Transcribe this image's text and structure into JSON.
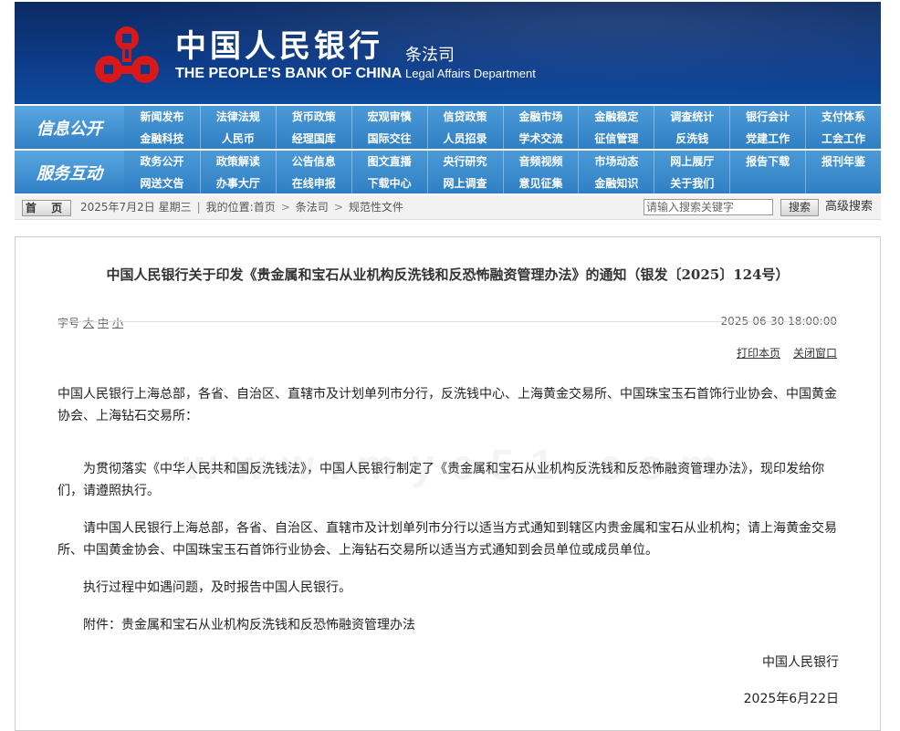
{
  "header": {
    "bank_name_cn": "中国人民银行",
    "bank_name_en": "THE PEOPLE'S BANK OF CHINA",
    "dept_cn": "条法司",
    "dept_en": "Legal Affairs Department",
    "logo_icon": "pboc-logo-icon",
    "logo_color": "#d7191b"
  },
  "nav": {
    "rows": [
      {
        "category": "信息公开",
        "items": [
          "新闻发布",
          "法律法规",
          "货币政策",
          "宏观审慎",
          "信贷政策",
          "金融市场",
          "金融稳定",
          "调查统计",
          "银行会计",
          "支付体系",
          "金融科技",
          "人民币",
          "经理国库",
          "国际交往",
          "人员招录",
          "学术交流",
          "征信管理",
          "反洗钱",
          "党建工作",
          "工会工作"
        ]
      },
      {
        "category": "服务互动",
        "items": [
          "政务公开",
          "政策解读",
          "公告信息",
          "图文直播",
          "央行研究",
          "音频视频",
          "市场动态",
          "网上展厅",
          "报告下载",
          "报刊年鉴",
          "网送文告",
          "办事大厅",
          "在线申报",
          "下载中心",
          "网上调查",
          "意见征集",
          "金融知识",
          "关于我们",
          "",
          ""
        ]
      }
    ]
  },
  "breadcrumb": {
    "home_label": "首 页",
    "date": "2025年7月2日 星期三",
    "location_label": "我的位置:",
    "crumbs": [
      "首页",
      "条法司",
      "规范性文件"
    ],
    "search_placeholder": "请输入搜索关键字",
    "search_button": "搜索",
    "advanced_search": "高级搜索"
  },
  "article": {
    "title": "中国人民银行关于印发《贵金属和宝石从业机构反洗钱和反恐怖融资管理办法》的通知（银发〔2025〕124号）",
    "font_size_label": "字号",
    "font_sizes": [
      "大",
      "中",
      "小"
    ],
    "publish_time": "2025-06-30 18:00:00",
    "print_label": "打印本页",
    "close_label": "关闭窗口",
    "addressee": "中国人民银行上海总部，各省、自治区、直辖市及计划单列市分行，反洗钱中心、上海黄金交易所、中国珠宝玉石首饰行业协会、中国黄金协会、上海钻石交易所：",
    "paragraphs": [
      "为贯彻落实《中华人民共和国反洗钱法》，中国人民银行制定了《贵金属和宝石从业机构反洗钱和反恐怖融资管理办法》，现印发给你们，请遵照执行。",
      "请中国人民银行上海总部，各省、自治区、直辖市及计划单列市分行以适当方式通知到辖区内贵金属和宝石从业机构；请上海黄金交易所、中国黄金协会、中国珠宝玉石首饰行业协会、上海钻石交易所以适当方式通知到会员单位或成员单位。",
      "执行过程中如遇问题，及时报告中国人民银行。",
      "附件：贵金属和宝石从业机构反洗钱和反恐怖融资管理办法"
    ],
    "signer": "中国人民银行",
    "sign_date": "2025年6月22日"
  },
  "watermark": "www.myc51.com"
}
